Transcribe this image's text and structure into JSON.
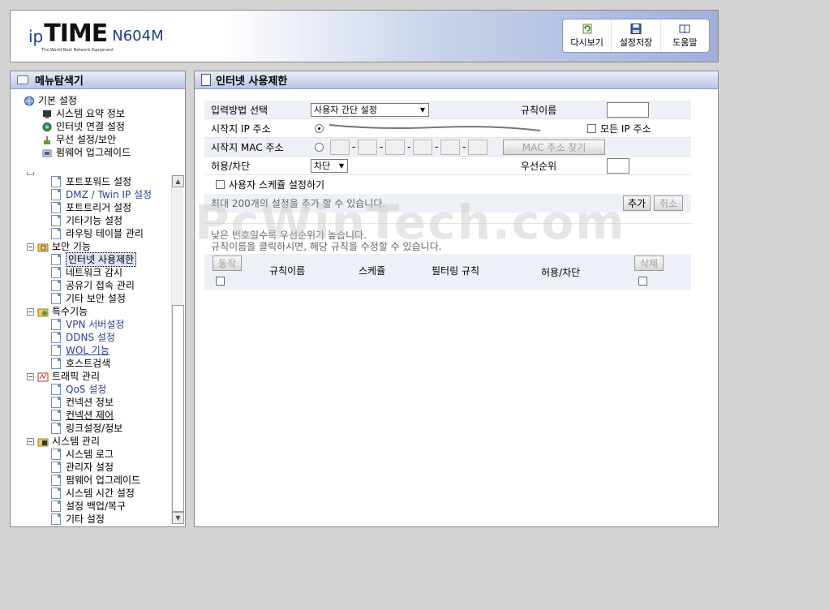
{
  "header": {
    "logo_ip": "ip",
    "logo_time": "TIME",
    "logo_tagline": "The World Best Network Equipment",
    "model": "N604M",
    "buttons": [
      {
        "label": "다시보기",
        "icon": "refresh-icon"
      },
      {
        "label": "설정저장",
        "icon": "save-icon"
      },
      {
        "label": "도움말",
        "icon": "help-book-icon"
      }
    ]
  },
  "sidebar": {
    "title": "메뉴탐색기",
    "basic": {
      "label": "기본 설정",
      "items": [
        "시스템 요약 정보",
        "인터넷 연결 설정",
        "무선 설정/보안",
        "펌웨어 업그레이드"
      ]
    },
    "nat_items": [
      "포트포워드 설정",
      "DMZ / Twin IP 설정",
      "포트트리거 설정",
      "기타기능 설정",
      "라우팅 테이블 관리"
    ],
    "security": {
      "label": "보안 기능",
      "items": [
        "인터넷 사용제한",
        "네트워크 감시",
        "공유기 접속 관리",
        "기타 보안 설정"
      ]
    },
    "special": {
      "label": "특수기능",
      "items": [
        "VPN 서버설정",
        "DDNS 설정",
        "WOL 기능",
        "호스트검색"
      ]
    },
    "traffic": {
      "label": "트래픽 관리",
      "items": [
        "QoS 설정",
        "컨넥션 정보",
        "컨넥션 제어",
        "링크설정/정보"
      ]
    },
    "system": {
      "label": "시스템 관리",
      "items": [
        "시스템 로그",
        "관리자 설정",
        "펌웨어 업그레이드",
        "시스템 시간 설정",
        "설정 백업/복구",
        "기타 설정"
      ]
    }
  },
  "main": {
    "title": "인터넷 사용제한",
    "input_method_label": "입력방법 선택",
    "input_method_value": "사용자 간단 설정",
    "rule_name_label": "규칙이름",
    "start_ip_label": "시작지 IP 주소",
    "all_ip_label": "모든 IP 주소",
    "start_mac_label": "시작지 MAC 주소",
    "mac_sep": "-",
    "mac_find_button": "MAC 주소 찾기",
    "allow_block_label": "허용/차단",
    "allow_block_value": "차단",
    "priority_label": "우선순위",
    "schedule_label": "사용자 스케쥴 설정하기",
    "max_note": "최대 200개의 설정을 추가 할 수 있습니다.",
    "add_button": "추가",
    "cancel_button": "취소",
    "priority_note": "낮은 번호일수록 우선순위가 높습니다.",
    "edit_note": "규칙이름을 클릭하시면, 해당 규칙을 수정할 수 있습니다.",
    "table": {
      "action_button": "동작",
      "headers": [
        "규칙이름",
        "스케쥴",
        "필터링 규칙",
        "허용/차단"
      ],
      "delete_button": "삭제"
    }
  },
  "watermark": "PcWinTech.com"
}
